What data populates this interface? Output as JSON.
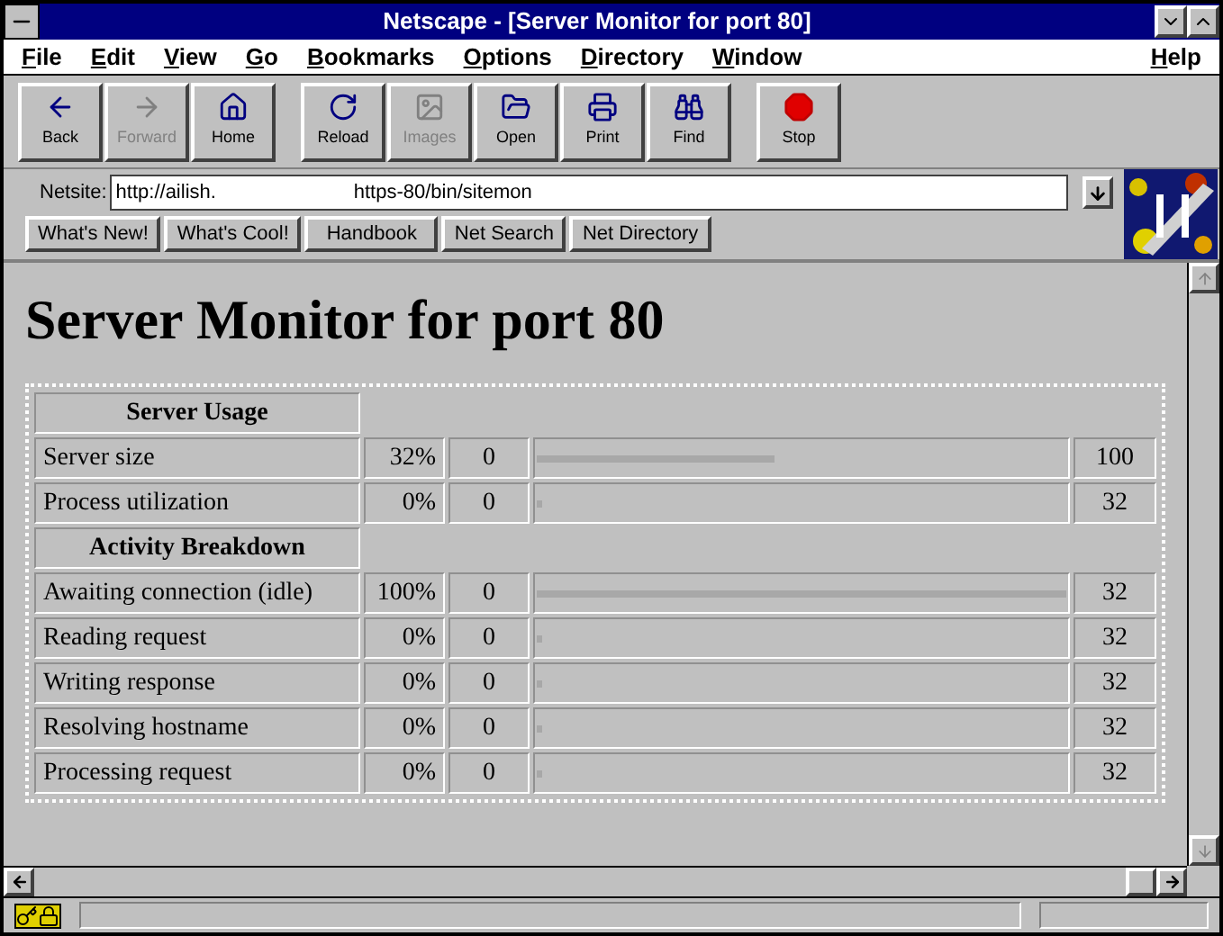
{
  "window": {
    "title": "Netscape - [Server Monitor for port 80]"
  },
  "menu": [
    {
      "label": "File"
    },
    {
      "label": "Edit"
    },
    {
      "label": "View"
    },
    {
      "label": "Go"
    },
    {
      "label": "Bookmarks"
    },
    {
      "label": "Options"
    },
    {
      "label": "Directory"
    },
    {
      "label": "Window"
    },
    {
      "label": "Help"
    }
  ],
  "toolbar": [
    {
      "label": "Back",
      "kind": "back",
      "disabled": false
    },
    {
      "label": "Forward",
      "kind": "forward",
      "disabled": true
    },
    {
      "label": "Home",
      "kind": "home",
      "disabled": false
    },
    {
      "label": "Reload",
      "kind": "reload",
      "disabled": false
    },
    {
      "label": "Images",
      "kind": "images",
      "disabled": true
    },
    {
      "label": "Open",
      "kind": "open",
      "disabled": false
    },
    {
      "label": "Print",
      "kind": "print",
      "disabled": false
    },
    {
      "label": "Find",
      "kind": "find",
      "disabled": false
    },
    {
      "label": "Stop",
      "kind": "stop",
      "disabled": false
    }
  ],
  "location": {
    "label": "Netsite:",
    "value": "http://ailish.                         https-80/bin/sitemon"
  },
  "directory_buttons": [
    "What's New!",
    "What's Cool!",
    "Handbook",
    "Net Search",
    "Net Directory"
  ],
  "page": {
    "heading": "Server Monitor for port 80",
    "rows": [
      {
        "kind": "header",
        "label": "Server Usage"
      },
      {
        "kind": "stat",
        "label": "Server size",
        "percent": "32%",
        "count": "0",
        "level": 0.45,
        "max": "100"
      },
      {
        "kind": "stat",
        "label": "Process utilization",
        "percent": "0%",
        "count": "0",
        "level": 0,
        "max": "32"
      },
      {
        "kind": "header",
        "label": "Activity Breakdown"
      },
      {
        "kind": "stat",
        "label": "Awaiting connection (idle)",
        "percent": "100%",
        "count": "0",
        "level": 1,
        "max": "32"
      },
      {
        "kind": "stat",
        "label": "Reading request",
        "percent": "0%",
        "count": "0",
        "level": 0,
        "max": "32"
      },
      {
        "kind": "stat",
        "label": "Writing response",
        "percent": "0%",
        "count": "0",
        "level": 0,
        "max": "32"
      },
      {
        "kind": "stat",
        "label": "Resolving hostname",
        "percent": "0%",
        "count": "0",
        "level": 0,
        "max": "32"
      },
      {
        "kind": "stat",
        "label": "Processing request",
        "percent": "0%",
        "count": "0",
        "level": 0,
        "max": "32"
      }
    ]
  }
}
